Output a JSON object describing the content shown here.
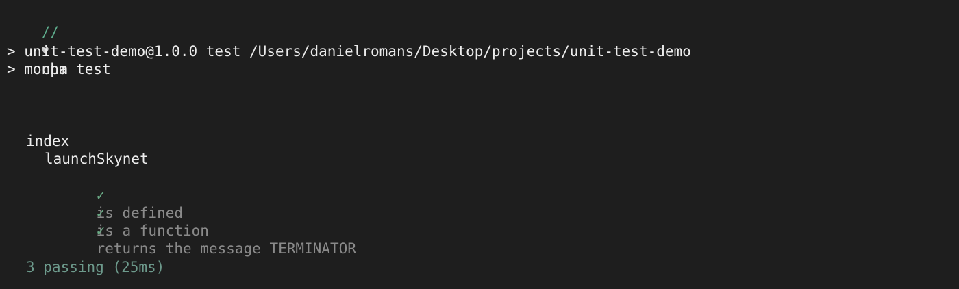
{
  "prompt": {
    "prefix": "//",
    "heart_icon": "♥",
    "command": "npm test"
  },
  "npm_output": [
    "> unit-test-demo@1.0.0 test /Users/danielromans/Desktop/projects/unit-test-demo",
    "> mocha"
  ],
  "suite": {
    "name": "index",
    "subsuite": "launchSkynet",
    "check_icon": "✓",
    "tests": [
      "is defined",
      "is a function",
      "returns the message TERMINATOR"
    ]
  },
  "summary": "3 passing (25ms)"
}
